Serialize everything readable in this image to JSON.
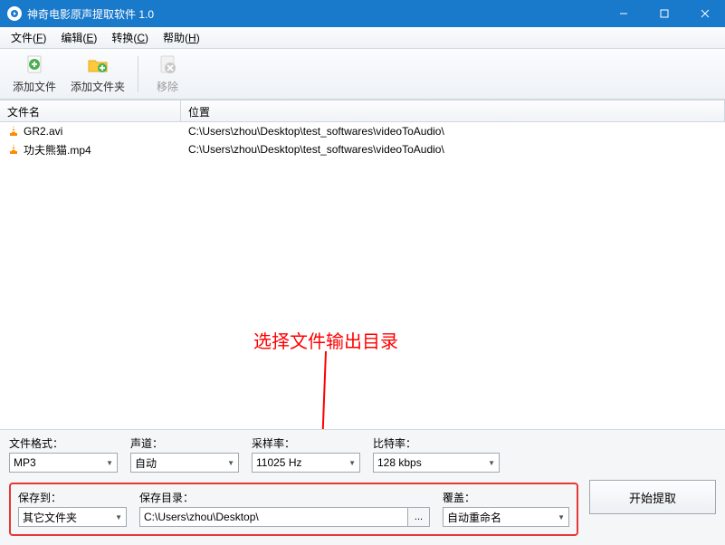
{
  "titlebar": {
    "title": "神奇电影原声提取软件 1.0"
  },
  "menu": {
    "file": "文件(",
    "file_key": "F",
    "file_end": ")",
    "edit": "编辑(",
    "edit_key": "E",
    "edit_end": ")",
    "convert": "转换(",
    "convert_key": "C",
    "convert_end": ")",
    "help": "帮助(",
    "help_key": "H",
    "help_end": ")"
  },
  "toolbar": {
    "add_file": "添加文件",
    "add_folder": "添加文件夹",
    "remove": "移除"
  },
  "list": {
    "col_name": "文件名",
    "col_location": "位置",
    "rows": [
      {
        "name": "GR2.avi",
        "location": "C:\\Users\\zhou\\Desktop\\test_softwares\\videoToAudio\\"
      },
      {
        "name": "功夫熊猫.mp4",
        "location": "C:\\Users\\zhou\\Desktop\\test_softwares\\videoToAudio\\"
      }
    ]
  },
  "annotation": {
    "text": "选择文件输出目录"
  },
  "settings": {
    "format_label": "文件格式：",
    "format_value": "MP3",
    "channel_label": "声道：",
    "channel_value": "自动",
    "rate_label": "采样率：",
    "rate_value": "11025 Hz",
    "bitrate_label": "比特率：",
    "bitrate_value": "128 kbps",
    "saveto_label": "保存到：",
    "saveto_value": "其它文件夹",
    "savedir_label": "保存目录：",
    "savedir_value": "C:\\Users\\zhou\\Desktop\\",
    "overwrite_label": "覆盖：",
    "overwrite_value": "自动重命名",
    "browse": "...",
    "start": "开始提取"
  }
}
